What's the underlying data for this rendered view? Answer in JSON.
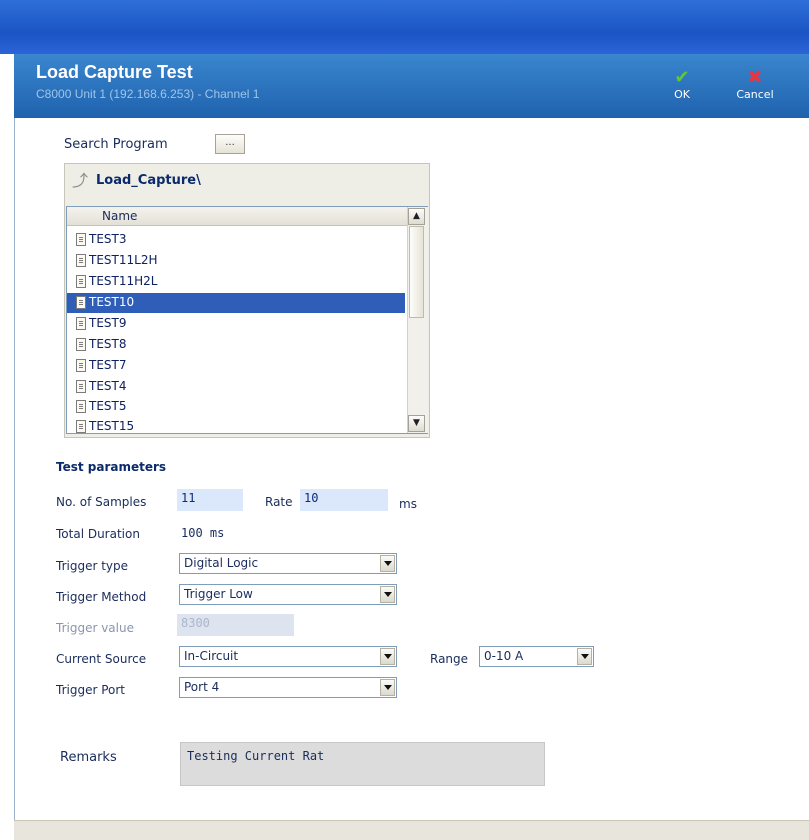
{
  "dialog": {
    "title": "Load Capture Test",
    "subtitle": "C8000 Unit 1 (192.168.6.253) - Channel 1",
    "ok_label": "OK",
    "cancel_label": "Cancel"
  },
  "search": {
    "label": "Search Program",
    "button_label": "..."
  },
  "browser": {
    "folder": "Load_Capture\\",
    "column_header": "Name",
    "files": [
      "TEST3",
      "TEST11L2H",
      "TEST11H2L",
      "TEST10",
      "TEST9",
      "TEST8",
      "TEST7",
      "TEST4",
      "TEST5",
      "TEST15"
    ],
    "selected": "TEST10"
  },
  "params": {
    "title": "Test parameters",
    "samples_label": "No. of Samples",
    "samples_value": "11",
    "rate_label": "Rate",
    "rate_value": "10",
    "rate_unit": "ms",
    "duration_label": "Total Duration",
    "duration_value": "100 ms",
    "trigger_type_label": "Trigger type",
    "trigger_type_value": "Digital Logic",
    "trigger_method_label": "Trigger Method",
    "trigger_method_value": "Trigger Low",
    "trigger_value_label": "Trigger value",
    "trigger_value_value": "8300",
    "current_source_label": "Current Source",
    "current_source_value": "In-Circuit",
    "range_label": "Range",
    "range_value": "0-10 A",
    "trigger_port_label": "Trigger Port",
    "trigger_port_value": "Port 4"
  },
  "remarks": {
    "label": "Remarks",
    "value": "Testing Current Rat"
  },
  "colors": {
    "header_blue": "#1f62ad",
    "selection": "#2f5eb8",
    "input_fill": "#dbe8fb"
  }
}
